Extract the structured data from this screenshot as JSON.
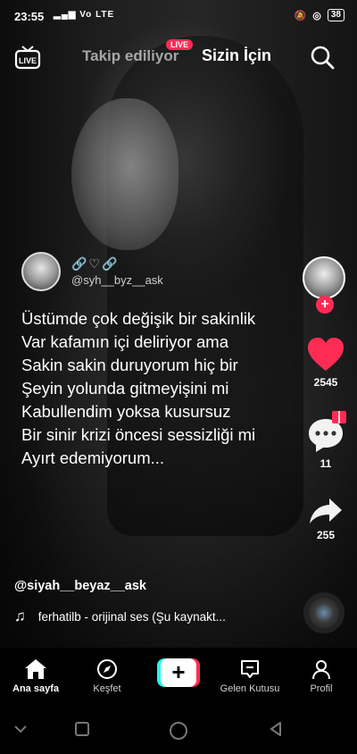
{
  "status_bar": {
    "time": "23:55",
    "signal": "Vo LTE",
    "battery": "38"
  },
  "top_nav": {
    "following_label": "Takip ediliyor",
    "live_badge": "LIVE",
    "for_you_label": "Sizin İçin",
    "live_button_label": "LIVE"
  },
  "post": {
    "overlay_username": "@syh__byz__ask",
    "overlay_icons": "🔗♡🔗",
    "caption_lines": [
      "Üstümde çok değişik bir sakinlik",
      "Var kafamın içi deliriyor ama",
      "Sakin sakin duruyorum hiç bir",
      "Şeyin yolunda gitmeyişini mi",
      "Kabullendim yoksa kusursuz",
      "Bir sinir krizi öncesi sessizliği mi",
      "Ayırt edemiyorum..."
    ],
    "author": "@siyah__beyaz__ask",
    "music": "ferhatilb - orijinal ses (Şu kaynakt..."
  },
  "right_rail": {
    "likes": "2545",
    "comments": "11",
    "shares": "255",
    "like_color": "#fe2c55"
  },
  "bottom_nav": {
    "home": "Ana sayfa",
    "discover": "Keşfet",
    "inbox": "Gelen Kutusu",
    "profile": "Profil"
  },
  "colors": {
    "accent_red": "#fe2c55",
    "accent_cyan": "#25f4ee"
  }
}
